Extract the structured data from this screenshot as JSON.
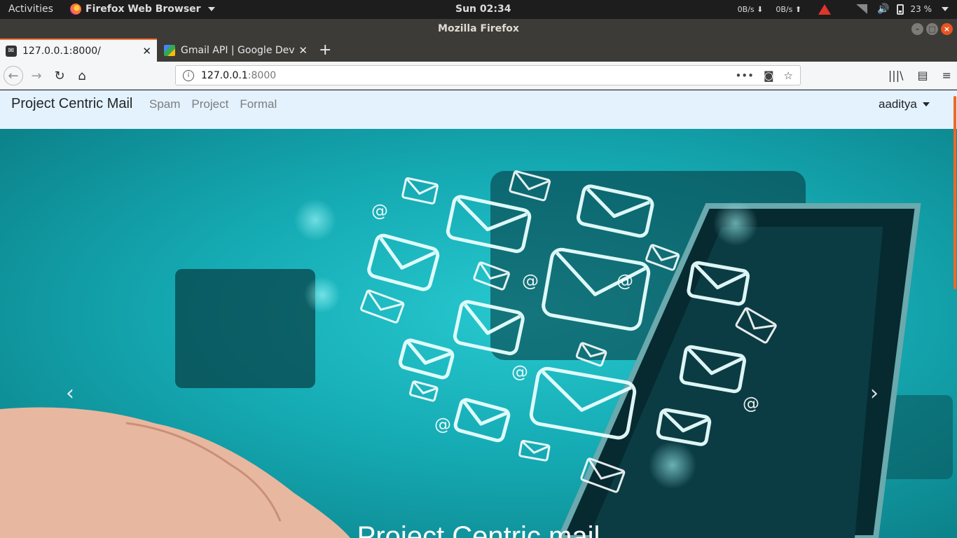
{
  "system": {
    "activities": "Activities",
    "app_menu": "Firefox Web Browser",
    "clock": "Sun 02:34",
    "net_down": "0B/s",
    "net_up": "0B/s",
    "battery": "23 %"
  },
  "window": {
    "title": "Mozilla Firefox",
    "min": "–",
    "max": "□",
    "close": "×"
  },
  "tabs": [
    {
      "label": "127.0.0.1:8000/",
      "active": true
    },
    {
      "label": "Gmail API | Google Deve",
      "active": false
    }
  ],
  "toolbar": {
    "back": "←",
    "forward": "→",
    "reload": "↻",
    "home": "⌂",
    "url_host": "127.0.0.1",
    "url_port": ":8000",
    "page_actions": "•••",
    "new_tab": "+"
  },
  "site": {
    "brand": "Project Centric Mail",
    "nav": [
      "Spam",
      "Project",
      "Formal"
    ],
    "user": "aaditya",
    "carousel_caption": "Project Centric mail",
    "prev": "‹",
    "next": "›"
  },
  "colors": {
    "nav_bg": "#e3f2fd",
    "hero_teal": "#15aab3",
    "accent": "#e95420"
  }
}
